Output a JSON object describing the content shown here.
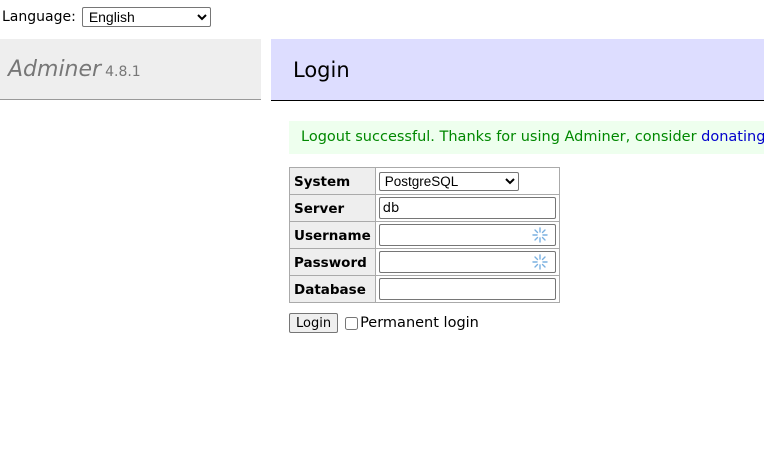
{
  "language": {
    "label": "Language:",
    "selected": "English"
  },
  "menu": {
    "app_name": "Adminer",
    "version": "4.8.1"
  },
  "header": {
    "title": "Login"
  },
  "message": {
    "text": "Logout successful. Thanks for using Adminer, consider ",
    "link": "donating."
  },
  "form": {
    "system_label": "System",
    "system_value": "PostgreSQL",
    "server_label": "Server",
    "server_value": "db",
    "username_label": "Username",
    "username_value": "",
    "password_label": "Password",
    "password_value": "",
    "database_label": "Database",
    "database_value": "",
    "password_manager_icon": "key-sparkle-icon"
  },
  "actions": {
    "login_label": "Login",
    "permanent_label": "Permanent login",
    "permanent_checked": false
  }
}
